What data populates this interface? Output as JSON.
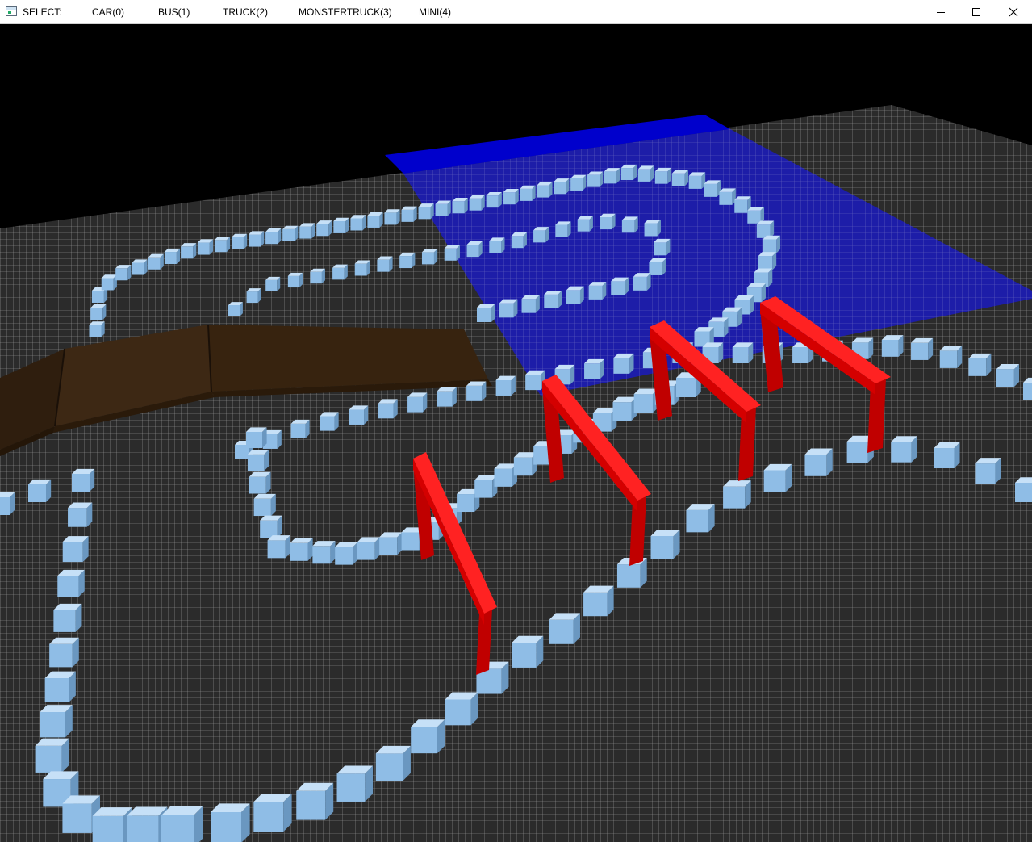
{
  "window": {
    "select_label": "SELECT:",
    "vehicles": [
      {
        "label": "CAR(0)"
      },
      {
        "label": "BUS(1)"
      },
      {
        "label": "TRUCK(2)"
      },
      {
        "label": "MONSTERTRUCK(3)"
      },
      {
        "label": "MINI(4)"
      }
    ],
    "controls": [
      "minimize-icon",
      "maximize-icon",
      "close-icon"
    ]
  },
  "scene": {
    "colors": {
      "background": "#000000",
      "ground": "#2b2b2b",
      "grid": "#bdbdbd",
      "water": "#0000c8",
      "ramp": "#3a2512",
      "cone": "#8fbde6",
      "gate": "#e00000"
    }
  }
}
